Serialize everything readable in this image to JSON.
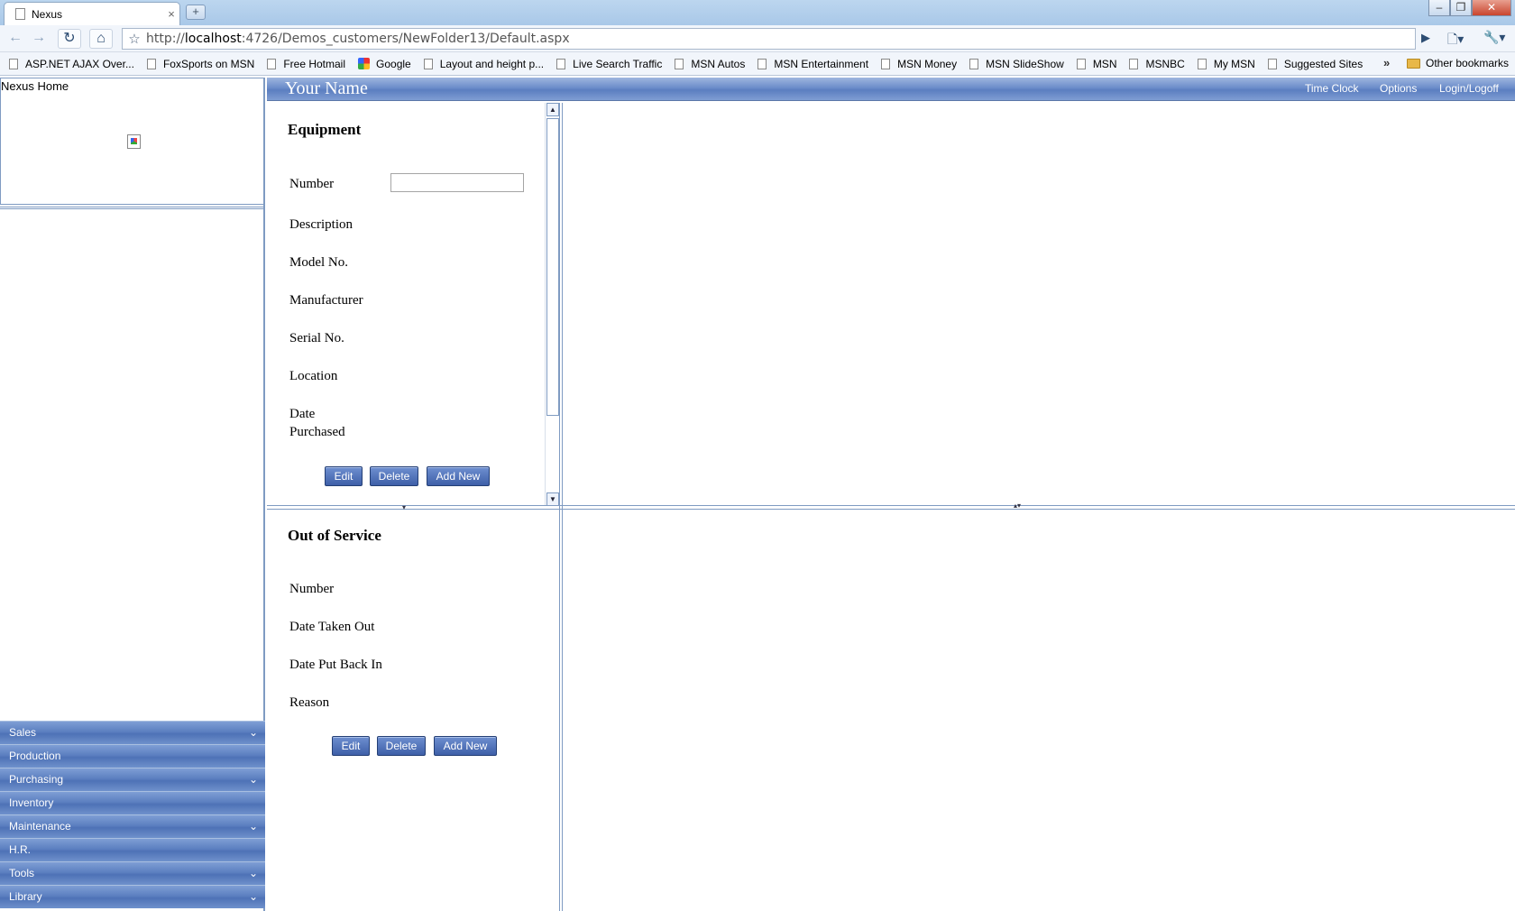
{
  "browser": {
    "tab_title": "Nexus",
    "tab_close": "×",
    "new_tab": "+",
    "url_prefix": "http://",
    "url_host": "localhost",
    "url_rest": ":4726/Demos_customers/NewFolder13/Default.aspx",
    "bookmarks": [
      "ASP.NET AJAX  Over...",
      "FoxSports on MSN",
      "Free Hotmail",
      "Google",
      "Layout and height p...",
      "Live Search Traffic",
      "MSN Autos",
      "MSN Entertainment",
      "MSN Money",
      "MSN SlideShow",
      "MSN",
      "MSNBC",
      "My MSN",
      "Suggested Sites"
    ],
    "more_bookmarks": "»",
    "other_bookmarks": "Other bookmarks"
  },
  "left": {
    "home_title": "Nexus Home",
    "menu": [
      {
        "label": "Sales",
        "chevron": "⌄"
      },
      {
        "label": "Production",
        "chevron": ""
      },
      {
        "label": "Purchasing",
        "chevron": "⌄"
      },
      {
        "label": "Inventory",
        "chevron": ""
      },
      {
        "label": "Maintenance",
        "chevron": "⌄"
      },
      {
        "label": "H.R.",
        "chevron": ""
      },
      {
        "label": "Tools",
        "chevron": "⌄"
      },
      {
        "label": "Library",
        "chevron": "⌄"
      }
    ]
  },
  "header": {
    "site_name": "Your Name",
    "links": {
      "time_clock": "Time Clock",
      "options": "Options",
      "login": "Login/Logoff"
    }
  },
  "equipment": {
    "title": "Equipment",
    "labels": {
      "number": "Number",
      "description": "Description",
      "model": "Model No.",
      "manufacturer": "Manufacturer",
      "serial": "Serial No.",
      "location": "Location",
      "date_purchased_1": "Date",
      "date_purchased_2": "Purchased"
    },
    "number_value": "",
    "buttons": {
      "edit": "Edit",
      "delete": "Delete",
      "add_new": "Add New"
    }
  },
  "out_of_service": {
    "title": "Out of Service",
    "labels": {
      "number": "Number",
      "date_taken_out": "Date Taken Out",
      "date_put_back": "Date Put Back In",
      "reason": "Reason"
    },
    "buttons": {
      "edit": "Edit",
      "delete": "Delete",
      "add_new": "Add New"
    }
  }
}
